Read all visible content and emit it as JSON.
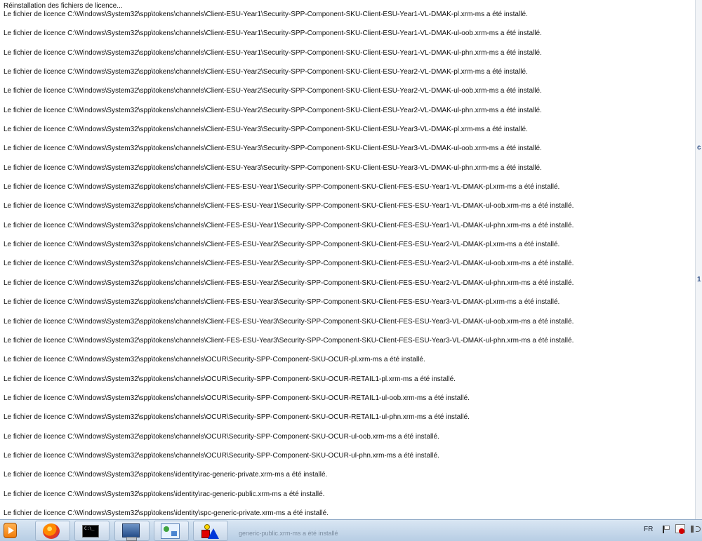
{
  "dialog": {
    "header": "Réinstallation des fichiers de licence...",
    "lines": [
      "Le fichier de licence C:\\Windows\\System32\\spp\\tokens\\channels\\Client-ESU-Year1\\Security-SPP-Component-SKU-Client-ESU-Year1-VL-DMAK-pl.xrm-ms a été installé.",
      "Le fichier de licence C:\\Windows\\System32\\spp\\tokens\\channels\\Client-ESU-Year1\\Security-SPP-Component-SKU-Client-ESU-Year1-VL-DMAK-ul-oob.xrm-ms a été installé.",
      "Le fichier de licence C:\\Windows\\System32\\spp\\tokens\\channels\\Client-ESU-Year1\\Security-SPP-Component-SKU-Client-ESU-Year1-VL-DMAK-ul-phn.xrm-ms a été installé.",
      "Le fichier de licence C:\\Windows\\System32\\spp\\tokens\\channels\\Client-ESU-Year2\\Security-SPP-Component-SKU-Client-ESU-Year2-VL-DMAK-pl.xrm-ms a été installé.",
      "Le fichier de licence C:\\Windows\\System32\\spp\\tokens\\channels\\Client-ESU-Year2\\Security-SPP-Component-SKU-Client-ESU-Year2-VL-DMAK-ul-oob.xrm-ms a été installé.",
      "Le fichier de licence C:\\Windows\\System32\\spp\\tokens\\channels\\Client-ESU-Year2\\Security-SPP-Component-SKU-Client-ESU-Year2-VL-DMAK-ul-phn.xrm-ms a été installé.",
      "Le fichier de licence C:\\Windows\\System32\\spp\\tokens\\channels\\Client-ESU-Year3\\Security-SPP-Component-SKU-Client-ESU-Year3-VL-DMAK-pl.xrm-ms a été installé.",
      "Le fichier de licence C:\\Windows\\System32\\spp\\tokens\\channels\\Client-ESU-Year3\\Security-SPP-Component-SKU-Client-ESU-Year3-VL-DMAK-ul-oob.xrm-ms a été installé.",
      "Le fichier de licence C:\\Windows\\System32\\spp\\tokens\\channels\\Client-ESU-Year3\\Security-SPP-Component-SKU-Client-ESU-Year3-VL-DMAK-ul-phn.xrm-ms a été installé.",
      "Le fichier de licence C:\\Windows\\System32\\spp\\tokens\\channels\\Client-FES-ESU-Year1\\Security-SPP-Component-SKU-Client-FES-ESU-Year1-VL-DMAK-pl.xrm-ms a été installé.",
      "Le fichier de licence C:\\Windows\\System32\\spp\\tokens\\channels\\Client-FES-ESU-Year1\\Security-SPP-Component-SKU-Client-FES-ESU-Year1-VL-DMAK-ul-oob.xrm-ms a été installé.",
      "Le fichier de licence C:\\Windows\\System32\\spp\\tokens\\channels\\Client-FES-ESU-Year1\\Security-SPP-Component-SKU-Client-FES-ESU-Year1-VL-DMAK-ul-phn.xrm-ms a été installé.",
      "Le fichier de licence C:\\Windows\\System32\\spp\\tokens\\channels\\Client-FES-ESU-Year2\\Security-SPP-Component-SKU-Client-FES-ESU-Year2-VL-DMAK-pl.xrm-ms a été installé.",
      "Le fichier de licence C:\\Windows\\System32\\spp\\tokens\\channels\\Client-FES-ESU-Year2\\Security-SPP-Component-SKU-Client-FES-ESU-Year2-VL-DMAK-ul-oob.xrm-ms a été installé.",
      "Le fichier de licence C:\\Windows\\System32\\spp\\tokens\\channels\\Client-FES-ESU-Year2\\Security-SPP-Component-SKU-Client-FES-ESU-Year2-VL-DMAK-ul-phn.xrm-ms a été installé.",
      "Le fichier de licence C:\\Windows\\System32\\spp\\tokens\\channels\\Client-FES-ESU-Year3\\Security-SPP-Component-SKU-Client-FES-ESU-Year3-VL-DMAK-pl.xrm-ms a été installé.",
      "Le fichier de licence C:\\Windows\\System32\\spp\\tokens\\channels\\Client-FES-ESU-Year3\\Security-SPP-Component-SKU-Client-FES-ESU-Year3-VL-DMAK-ul-oob.xrm-ms a été installé.",
      "Le fichier de licence C:\\Windows\\System32\\spp\\tokens\\channels\\Client-FES-ESU-Year3\\Security-SPP-Component-SKU-Client-FES-ESU-Year3-VL-DMAK-ul-phn.xrm-ms a été installé.",
      "Le fichier de licence C:\\Windows\\System32\\spp\\tokens\\channels\\OCUR\\Security-SPP-Component-SKU-OCUR-pl.xrm-ms a été installé.",
      "Le fichier de licence C:\\Windows\\System32\\spp\\tokens\\channels\\OCUR\\Security-SPP-Component-SKU-OCUR-RETAIL1-pl.xrm-ms a été installé.",
      "Le fichier de licence C:\\Windows\\System32\\spp\\tokens\\channels\\OCUR\\Security-SPP-Component-SKU-OCUR-RETAIL1-ul-oob.xrm-ms a été installé.",
      "Le fichier de licence C:\\Windows\\System32\\spp\\tokens\\channels\\OCUR\\Security-SPP-Component-SKU-OCUR-RETAIL1-ul-phn.xrm-ms a été installé.",
      "Le fichier de licence C:\\Windows\\System32\\spp\\tokens\\channels\\OCUR\\Security-SPP-Component-SKU-OCUR-ul-oob.xrm-ms a été installé.",
      "Le fichier de licence C:\\Windows\\System32\\spp\\tokens\\channels\\OCUR\\Security-SPP-Component-SKU-OCUR-ul-phn.xrm-ms a été installé.",
      "Le fichier de licence C:\\Windows\\System32\\spp\\tokens\\identity\\rac-generic-private.xrm-ms a été installé.",
      "Le fichier de licence C:\\Windows\\System32\\spp\\tokens\\identity\\rac-generic-public.xrm-ms a été installé.",
      "Le fichier de licence C:\\Windows\\System32\\spp\\tokens\\identity\\spc-generic-private.xrm-ms a été installé."
    ]
  },
  "taskbar": {
    "language": "FR",
    "ghost_text": "generic-public.xrm-ms a été installé",
    "items": [
      {
        "name": "start-orb",
        "icon": "media-player-icon"
      },
      {
        "name": "firefox",
        "icon": "firefox-icon"
      },
      {
        "name": "command-prompt",
        "icon": "cmd-icon"
      },
      {
        "name": "computer",
        "icon": "computer-icon"
      },
      {
        "name": "control-panel",
        "icon": "control-panel-icon"
      },
      {
        "name": "shapes-app",
        "icon": "shapes-icon"
      }
    ]
  },
  "right_strip": {
    "marks": [
      "c",
      "1"
    ]
  },
  "colors": {
    "text": "#111111",
    "taskbar_top": "#d9e6f3",
    "taskbar_bottom": "#b7cde4"
  }
}
